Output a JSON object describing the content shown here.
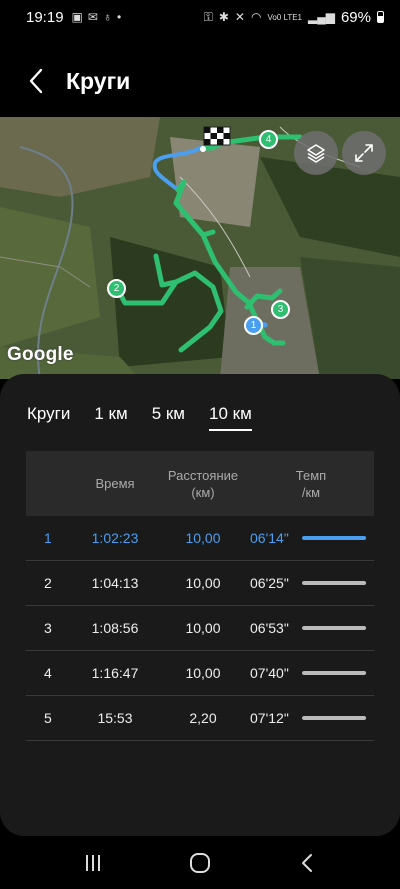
{
  "status_bar": {
    "time": "19:19",
    "network": "Vo0 LTE1",
    "battery_percent": "69%",
    "battery_level": 0.69
  },
  "header": {
    "title": "Круги"
  },
  "map": {
    "google_label": "Google",
    "markers": [
      "1",
      "2",
      "3",
      "4"
    ]
  },
  "tabs": [
    {
      "label": "Круги",
      "active": false
    },
    {
      "label": "1 км",
      "active": false
    },
    {
      "label": "5 км",
      "active": false
    },
    {
      "label": "10 км",
      "active": true
    }
  ],
  "table": {
    "headers": {
      "time": "Время",
      "distance": "Расстояние\n(км)",
      "pace": "Темп\n/км"
    },
    "rows": [
      {
        "n": "1",
        "time": "1:02:23",
        "distance": "10,00",
        "pace": "06'14\"",
        "pace_fraction": 0.99,
        "highlight": true
      },
      {
        "n": "2",
        "time": "1:04:13",
        "distance": "10,00",
        "pace": "06'25\"",
        "pace_fraction": 0.99,
        "highlight": false
      },
      {
        "n": "3",
        "time": "1:08:56",
        "distance": "10,00",
        "pace": "06'53\"",
        "pace_fraction": 0.99,
        "highlight": false
      },
      {
        "n": "4",
        "time": "1:16:47",
        "distance": "10,00",
        "pace": "07'40\"",
        "pace_fraction": 0.99,
        "highlight": false
      },
      {
        "n": "5",
        "time": "15:53",
        "distance": "2,20",
        "pace": "07'12\"",
        "pace_fraction": 0.99,
        "highlight": false
      }
    ]
  },
  "colors": {
    "accent": "#4a9ff0",
    "route": "#2fbf71",
    "sheet": "#1a1a1a"
  }
}
